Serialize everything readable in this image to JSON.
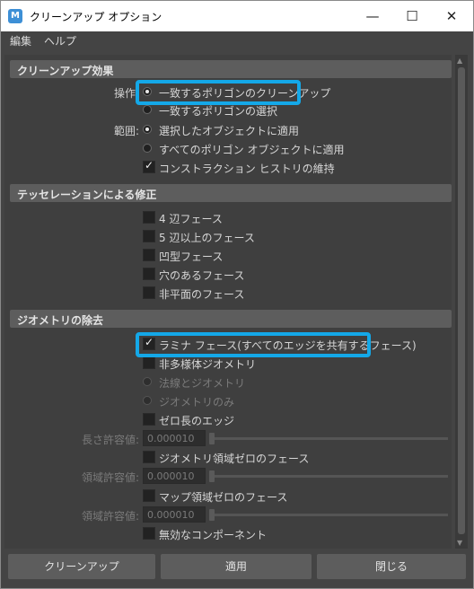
{
  "window": {
    "title": "クリーンアップ オプション",
    "icon_letter": "M",
    "controls": [
      "—",
      "☐",
      "✕"
    ]
  },
  "menu": [
    "編集",
    "ヘルプ"
  ],
  "sections": {
    "effect": {
      "title": "クリーンアップ効果",
      "operation_label": "操作:",
      "operation_options": [
        "一致するポリゴンのクリーンアップ",
        "一致するポリゴンの選択"
      ],
      "operation_selected": 0,
      "scope_label": "範囲:",
      "scope_options": [
        "選択したオブジェクトに適用",
        "すべてのポリゴン オブジェクトに適用"
      ],
      "scope_selected": 0,
      "keep_history": {
        "label": "コンストラクション ヒストリの維持",
        "checked": true
      }
    },
    "tessellation": {
      "title": "テッセレーションによる修正",
      "items": [
        {
          "label": "4 辺フェース",
          "checked": false
        },
        {
          "label": "5 辺以上のフェース",
          "checked": false
        },
        {
          "label": "凹型フェース",
          "checked": false
        },
        {
          "label": "穴のあるフェース",
          "checked": false
        },
        {
          "label": "非平面のフェース",
          "checked": false
        }
      ]
    },
    "geometry": {
      "title": "ジオメトリの除去",
      "lamina": {
        "label": "ラミナ フェース(すべてのエッジを共有するフェース)",
        "checked": true
      },
      "nonmanifold": {
        "label": "非多様体ジオメトリ",
        "checked": false
      },
      "nonmanifold_options": [
        "法線とジオメトリ",
        "ジオメトリのみ"
      ],
      "zero_edge": {
        "label": "ゼロ長のエッジ",
        "checked": false
      },
      "length_tolerance": {
        "label": "長さ許容値:",
        "value": "0.000010"
      },
      "zero_face": {
        "label": "ジオメトリ領域ゼロのフェース",
        "checked": false
      },
      "area_tolerance": {
        "label": "領域許容値:",
        "value": "0.000010"
      },
      "zero_map": {
        "label": "マップ領域ゼロのフェース",
        "checked": false
      },
      "map_tolerance": {
        "label": "領域許容値:",
        "value": "0.000010"
      },
      "invalid": {
        "label": "無効なコンポーネント",
        "checked": false
      }
    }
  },
  "buttons": {
    "cleanup": "クリーンアップ",
    "apply": "適用",
    "close": "閉じる"
  },
  "highlight_color": "#14a8e8"
}
